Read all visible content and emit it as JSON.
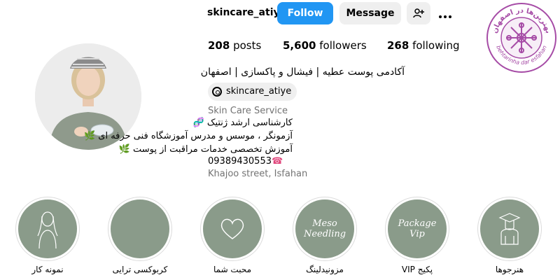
{
  "header": {
    "username": "skincare_atiye",
    "follow_label": "Follow",
    "message_label": "Message"
  },
  "stats": {
    "posts_count": "208",
    "posts_label": "posts",
    "followers_count": "5,600",
    "followers_label": "followers",
    "following_count": "268",
    "following_label": "following"
  },
  "bio": {
    "name": "آکادمی پوست عطیه | فیشال و پاکسازی | اصفهان",
    "threads_handle": "skincare_atiye",
    "category": "Skin Care Service",
    "line1": "کارشناسی ارشد ژنتیک",
    "line2": "آزمونگر ، موسس و مدرس آموزشگاه فنی حرفه ای",
    "line3": "آموزش تخصصی خدمات مراقبت از پوست",
    "phone": "09389430553",
    "address": "Khajoo street, Isfahan"
  },
  "logo": {
    "text_top": "بهترین‌ها در اصفهان",
    "text_bottom": "behtarinha dar esfahan"
  },
  "highlights": [
    {
      "label": "نمونه کار",
      "icon": "woman-silhouette-icon"
    },
    {
      "label": "کربوکسی ترایی",
      "icon": "blank-cover"
    },
    {
      "label": "محبت شما",
      "icon": "heart-icon"
    },
    {
      "label": "مزونیدلینگ",
      "icon": "meso-needling-text",
      "cover_text_1": "Meso",
      "cover_text_2": "Needling"
    },
    {
      "label": "پکیج VIP",
      "icon": "package-vip-text",
      "cover_text_1": "Package",
      "cover_text_2": "Vip"
    },
    {
      "label": "هنرجوها",
      "icon": "graduates-icon"
    }
  ],
  "colors": {
    "follow_button": "#2196f3",
    "highlight_cover": "#8a9b8a",
    "logo_accent": "#a64ca6",
    "secondary_text": "#737373"
  }
}
